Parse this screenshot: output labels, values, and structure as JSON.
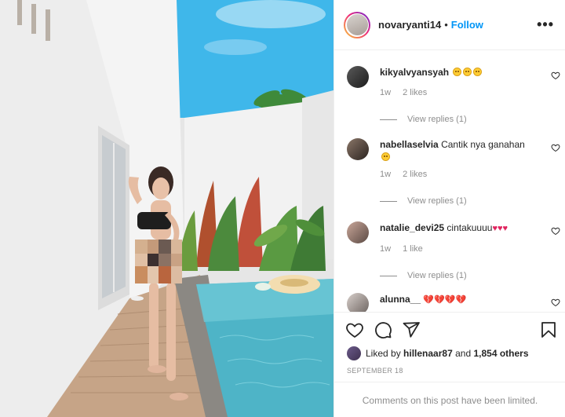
{
  "post": {
    "username": "novaryanti14",
    "separator": "•",
    "follow_label": "Follow",
    "more_label": "•••"
  },
  "comments": [
    {
      "username": "kikyalvyansyah",
      "text": "",
      "emojis": 3,
      "age": "1w",
      "likes": "2 likes",
      "replies": "View replies (1)"
    },
    {
      "username": "nabellaselvia",
      "text": "Cantik nya ganahan",
      "emojis": 1,
      "age": "1w",
      "likes": "2 likes",
      "replies": "View replies (1)"
    },
    {
      "username": "natalie_devi25",
      "text": "cintakuuuu",
      "hearts": "♥♥♥",
      "age": "1w",
      "likes": "1 like",
      "replies": "View replies (1)"
    },
    {
      "username": "alunna__",
      "text": "",
      "broken_hearts": "💔💔💔💔"
    }
  ],
  "liked_by": {
    "prefix": "Liked by",
    "user": "hillenaar87",
    "conjunction": "and",
    "others": "1,854 others"
  },
  "date": "SEPTEMBER 18",
  "limited_notice": "Comments on this post have been limited.",
  "icons": {
    "like": "heart-icon",
    "comment": "comment-icon",
    "share": "share-icon",
    "save": "bookmark-icon",
    "comment_like": "small-heart-icon",
    "more": "more-icon"
  },
  "colors": {
    "accent": "#0095f6",
    "text": "#262626",
    "muted": "#8e8e8e",
    "heart": "#e0245e"
  }
}
